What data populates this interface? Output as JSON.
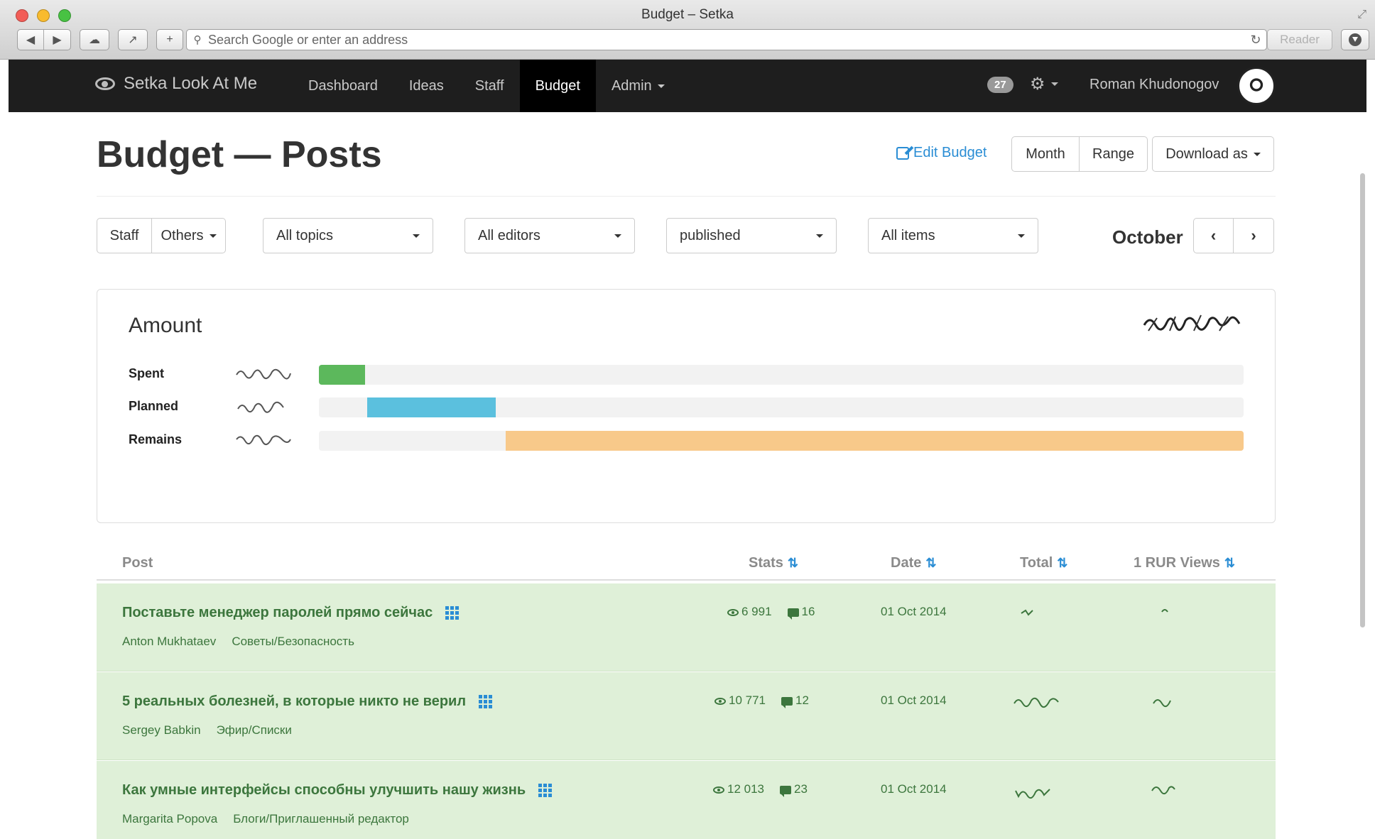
{
  "browser": {
    "window_title": "Budget – Setka",
    "address_placeholder": "Search Google or enter an address",
    "reader_label": "Reader"
  },
  "navbar": {
    "brand": "Setka Look At Me",
    "links": [
      "Dashboard",
      "Ideas",
      "Staff",
      "Budget",
      "Admin"
    ],
    "active_link": "Budget",
    "notification_count": "27",
    "user_name": "Roman Khudonogov"
  },
  "header": {
    "title": "Budget — Posts",
    "edit_label": "Edit Budget",
    "month_button": "Month",
    "range_button": "Range",
    "download_button": "Download as"
  },
  "filters": {
    "staff_button": "Staff",
    "others_button": "Others",
    "topics": "All topics",
    "editors": "All editors",
    "status": "published",
    "items": "All items",
    "month": "October"
  },
  "amount_panel": {
    "title": "Amount",
    "bars": [
      {
        "label": "Spent",
        "start": 0.0,
        "fraction": 0.05,
        "color": "#5cb85c"
      },
      {
        "label": "Planned",
        "start": 0.052,
        "fraction": 0.139,
        "color": "#5bc0de"
      },
      {
        "label": "Remains",
        "start": 0.202,
        "fraction": 0.798,
        "color": "#f8c98a"
      }
    ]
  },
  "table": {
    "columns": [
      "Post",
      "Stats",
      "Date",
      "Total",
      "1 RUR Views"
    ],
    "rows": [
      {
        "title": "Поставьте менеджер паролей прямо сейчас",
        "author": "Anton Mukhataev",
        "category": "Советы/Безопасность",
        "views": "6 991",
        "comments": "16",
        "date": "01 Oct 2014"
      },
      {
        "title": "5 реальных болезней, в которые никто не верил",
        "author": "Sergey Babkin",
        "category": "Эфир/Списки",
        "views": "10 771",
        "comments": "12",
        "date": "01 Oct 2014"
      },
      {
        "title": "Как умные интерфейсы способны улучшить нашу жизнь",
        "author": "Margarita Popova",
        "category": "Блоги/Приглашенный редактор",
        "views": "12 013",
        "comments": "23",
        "date": "01 Oct 2014"
      }
    ]
  }
}
